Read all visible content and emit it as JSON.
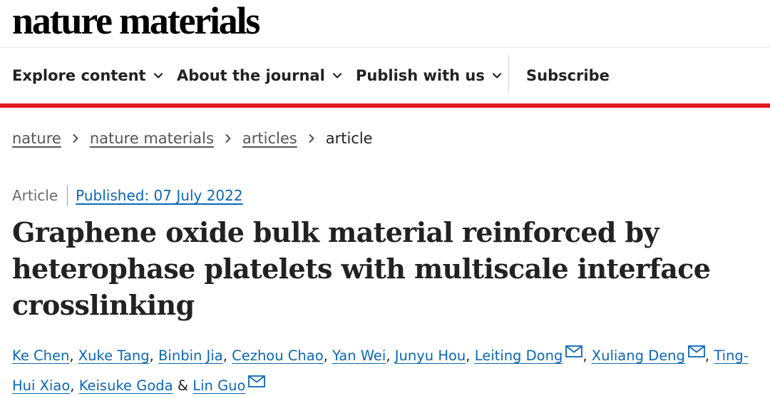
{
  "brand": "nature materials",
  "nav": {
    "explore": "Explore content",
    "about": "About the journal",
    "publish": "Publish with us",
    "subscribe": "Subscribe"
  },
  "breadcrumb": {
    "items": [
      "nature",
      "nature materials",
      "articles"
    ],
    "current": "article"
  },
  "article": {
    "type": "Article",
    "published": "Published: 07 July 2022",
    "title": "Graphene oxide bulk material reinforced by heterophase platelets with multiscale interface crosslinking"
  },
  "authors": {
    "list": [
      "Ke Chen",
      "Xuke Tang",
      "Binbin Jia",
      "Cezhou Chao",
      "Yan Wei",
      "Junyu Hou",
      "Leiting Dong",
      "Xuliang Deng",
      "Ting-Hui Xiao",
      "Keisuke Goda",
      "Lin Guo"
    ],
    "separator": ", ",
    "last_separator": " & "
  },
  "colors": {
    "accent_red": "#e0181f",
    "link_blue": "#0b66b8"
  },
  "icons": {
    "nav_dropdown": "chevron-down-icon",
    "breadcrumb_separator": "chevron-right-icon",
    "corresponding_author": "envelope-icon"
  }
}
